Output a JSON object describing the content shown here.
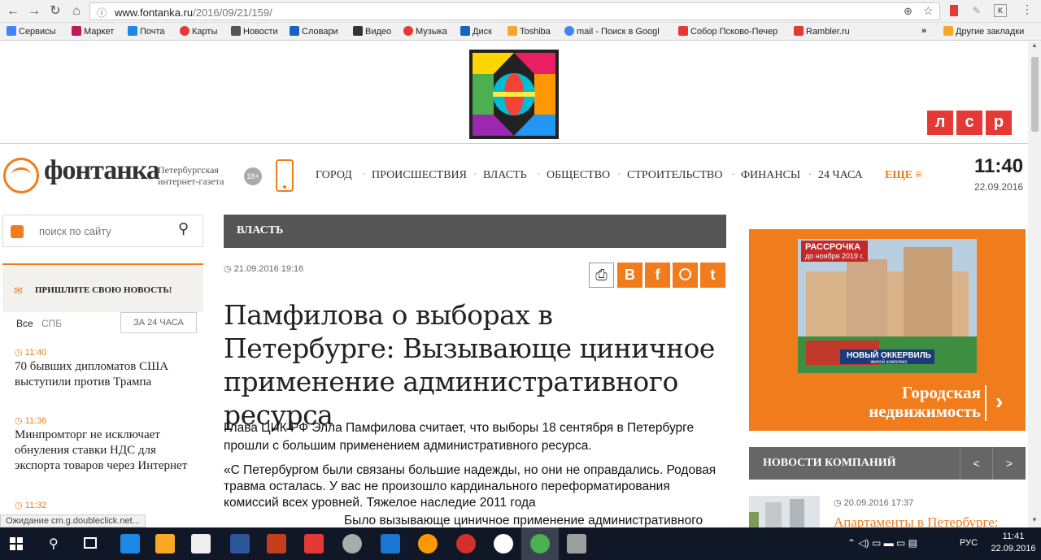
{
  "browser": {
    "url_host": "www.fontanka.ru",
    "url_path": "/2016/09/21/159/",
    "bookmarks": [
      "Сервисы",
      "Маркет",
      "Почта",
      "Карты",
      "Новости",
      "Словари",
      "Видео",
      "Музыка",
      "Диск",
      "Toshiba",
      "mail - Поиск в Googl",
      "Собор Псково-Печер",
      "Rambler.ru"
    ],
    "bookmarks_more": "»",
    "other_bookmarks": "Другие закладки",
    "status": "Ожидание cm.g.doubleclick.net..."
  },
  "banner": {
    "lsr": [
      "л",
      "с",
      "р"
    ]
  },
  "header": {
    "logo_text": "фонтанка",
    "tagline1": "Петербургская",
    "tagline2": "интернет-газета",
    "age": "18+",
    "nav": [
      "ГОРОД",
      "ПРОИСШЕСТВИЯ",
      "ВЛАСТЬ",
      "ОБЩЕСТВО",
      "СТРОИТЕЛЬСТВО",
      "ФИНАНСЫ",
      "24 ЧАСА"
    ],
    "more": "ЕЩЕ",
    "time": "11:40",
    "date": "22.09.2016"
  },
  "sidebar": {
    "search_placeholder": "поиск по сайту",
    "send_news": "ПРИШЛИТЕ СВОЮ НОВОСТЬ!",
    "tabs": [
      "Все",
      "СПБ"
    ],
    "period_button": "ЗА 24 ЧАСА",
    "news": [
      {
        "time": "11:40",
        "title": "70 бывших дипломатов США выступили против Трампа"
      },
      {
        "time": "11:36",
        "title": "Минпромторг не исключает обнуления ставки НДС для экспорта товаров через Интернет"
      },
      {
        "time": "11:32",
        "title": ""
      }
    ]
  },
  "article": {
    "section": "ВЛАСТЬ",
    "datetime": "21.09.2016 19:16",
    "share": [
      "B",
      "f",
      "",
      "t"
    ],
    "title": "Памфилова о выборах в Петербурге: Вызывающе циничное применение административного ресурса",
    "p1": "Глава ЦИК РФ Элла Памфилова считает, что выборы 18 сентября в Петербурге прошли с большим применением административного ресурса.",
    "p2": "«С Петербургом были связаны большие надежды, но они не оправдались. Родовая травма осталась. У вас не произошло кардинального переформатирования комиссий всех уровней. Тяжелое наследие 2011 года",
    "p3": "Было вызывающе циничное применение административного"
  },
  "right": {
    "ad_badge1": "РАССРОЧКА",
    "ad_badge2": "до ноября 2019 г.",
    "ad_sign": "НОВЫЙ ОККЕРВИЛЬ",
    "ad_sign_sub": "жилой комплекс",
    "ad_cta1": "Городская",
    "ad_cta2": "недвижимость",
    "company_news": "НОВОСТИ КОМПАНИЙ",
    "prev": "<",
    "next": ">",
    "item_time": "20.09.2016 17:37",
    "item_title": "Апартаменты в Петербурге:"
  },
  "taskbar": {
    "lang": "РУС",
    "time": "11:41",
    "date": "22.09.2016"
  }
}
